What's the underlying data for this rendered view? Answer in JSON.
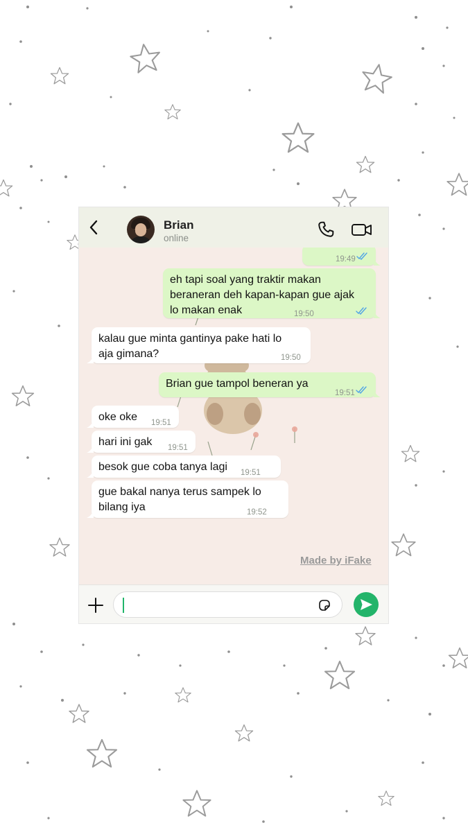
{
  "header": {
    "contact_name": "Brian",
    "status": "online"
  },
  "messages": [
    {
      "direction": "outgoing",
      "text": "",
      "time": "19:49",
      "read": true
    },
    {
      "direction": "outgoing",
      "text": "eh tapi soal yang traktir makan\nberaneran deh kapan-kapan gue ajak\nlo makan enak",
      "time": "19:50",
      "read": true
    },
    {
      "direction": "incoming",
      "text": "kalau gue minta gantinya pake hati lo\naja gimana?",
      "time": "19:50"
    },
    {
      "direction": "outgoing",
      "text": "Brian gue tampol beneran ya",
      "time": "19:51",
      "read": true
    },
    {
      "direction": "incoming",
      "text": "oke oke",
      "time": "19:51"
    },
    {
      "direction": "incoming",
      "text": "hari ini gak",
      "time": "19:51"
    },
    {
      "direction": "incoming",
      "text": "besok gue coba tanya lagi",
      "time": "19:51"
    },
    {
      "direction": "incoming",
      "text": "gue bakal nanya terus sampek lo\nbilang iya",
      "time": "19:52"
    }
  ],
  "watermark": "Made by iFake",
  "input": {
    "value": ""
  },
  "colors": {
    "outgoing_bubble": "#dcf7c6",
    "incoming_bubble": "#ffffff",
    "send_button": "#23b46a",
    "read_ticks": "#4fa3e6",
    "chat_background": "#f7ece7"
  },
  "icons": [
    "back-chevron-icon",
    "phone-icon",
    "video-camera-icon",
    "plus-icon",
    "sticker-icon",
    "send-icon",
    "double-check-icon"
  ]
}
